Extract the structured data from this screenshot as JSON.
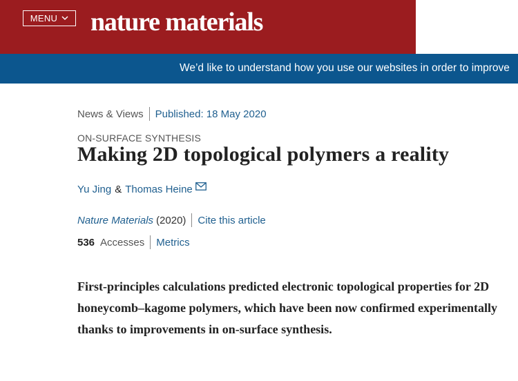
{
  "header": {
    "menu_label": "MENU",
    "brand": "nature materials",
    "brand_color": "#9b1c1f"
  },
  "banner": {
    "text": "We’d like to understand how you use our websites in order to improve"
  },
  "article": {
    "type": "News & Views",
    "published": "Published: 18 May 2020",
    "subject": "ON-SURFACE SYNTHESIS",
    "title": "Making 2D topological polymers a reality",
    "authors": [
      "Yu Jing",
      "Thomas Heine"
    ],
    "author_separator": "&",
    "journal": "Nature Materials",
    "year": "(2020)",
    "cite_label": "Cite this article",
    "accesses_count": "536",
    "accesses_label": "Accesses",
    "metrics_label": "Metrics",
    "abstract": "First-principles calculations predicted electronic topological properties for 2D honeycomb–kagome polymers, which have been now confirmed experimentally thanks to improvements in on-surface synthesis."
  },
  "colors": {
    "link": "#1f5f8f",
    "banner": "#0c568e"
  }
}
